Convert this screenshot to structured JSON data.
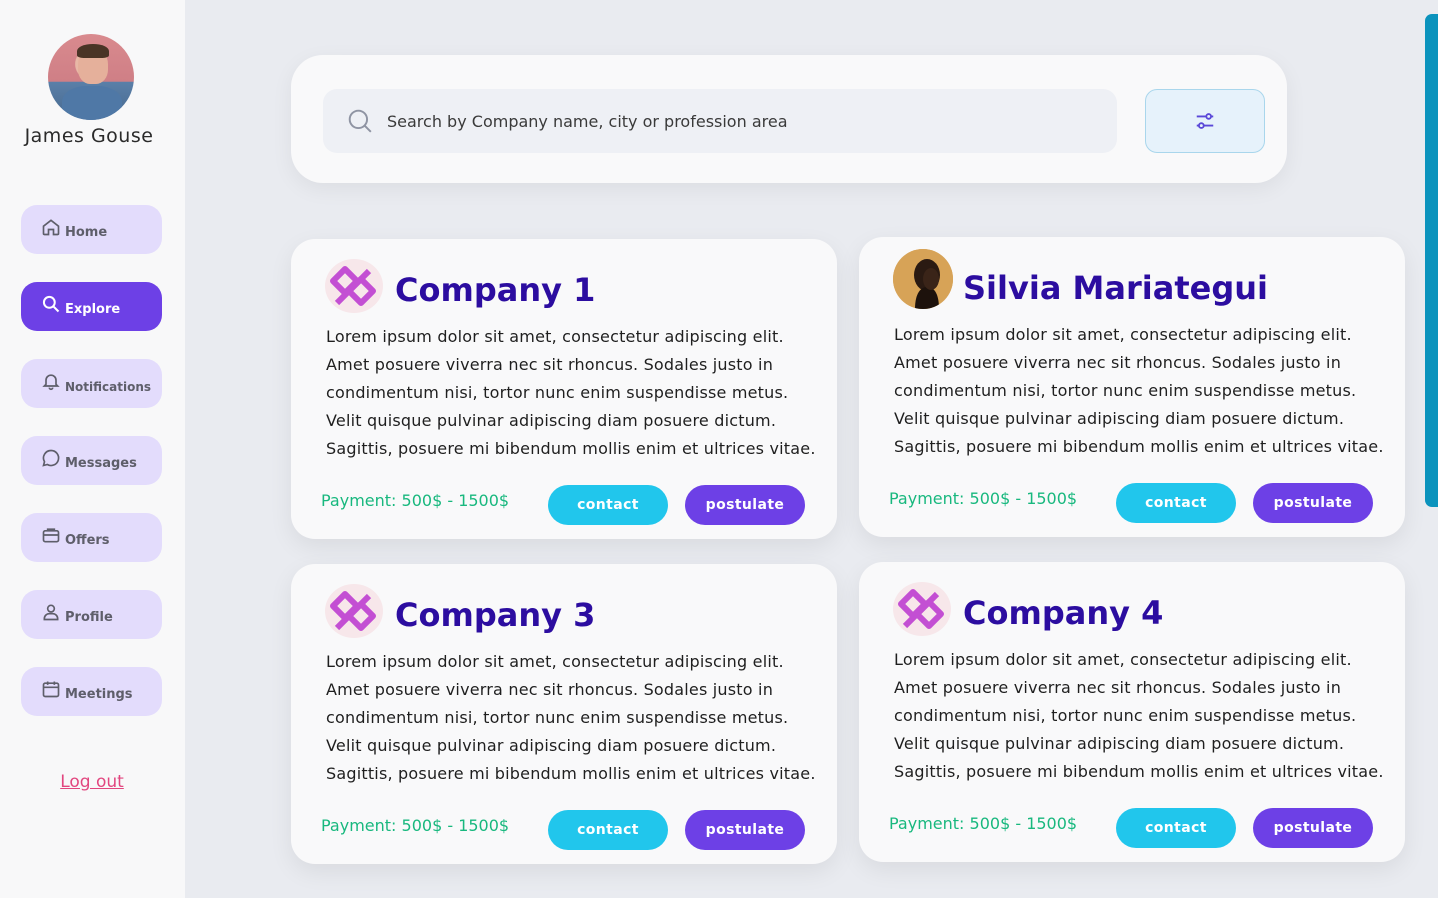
{
  "user": {
    "name": "James Gouse"
  },
  "nav": [
    {
      "label": "Home",
      "icon": "home-icon"
    },
    {
      "label": "Explore",
      "icon": "search-icon",
      "active": true
    },
    {
      "label": "Notifications",
      "icon": "bell-icon"
    },
    {
      "label": "Messages",
      "icon": "chat-icon"
    },
    {
      "label": "Offers",
      "icon": "briefcase-icon"
    },
    {
      "label": "Profile",
      "icon": "user-icon"
    },
    {
      "label": "Meetings",
      "icon": "calendar-icon"
    }
  ],
  "logout_label": "Log out",
  "search": {
    "placeholder": "Search by Company name, city or profession area",
    "value": ""
  },
  "cards": [
    {
      "title": "Company 1",
      "description": "Lorem ipsum dolor sit amet, consectetur adipiscing elit. Amet posuere viverra nec sit rhoncus. Sodales justo in condimentum nisi, tortor nunc enim suspendisse metus. Velit quisque pulvinar adipiscing diam posuere dictum. Sagittis, posuere mi bibendum mollis enim et ultrices vitae.",
      "payment": "Payment: 500$ - 1500$",
      "contact_label": "contact",
      "postulate_label": "postulate"
    },
    {
      "title": "Silvia Mariategui",
      "description": "Lorem ipsum dolor sit amet, consectetur adipiscing elit. Amet posuere viverra nec sit rhoncus. Sodales justo in condimentum nisi, tortor nunc enim suspendisse metus. Velit quisque pulvinar adipiscing diam posuere dictum. Sagittis, posuere mi bibendum mollis enim et ultrices vitae.",
      "payment": "Payment: 500$ - 1500$",
      "contact_label": "contact",
      "postulate_label": "postulate"
    },
    {
      "title": "Company 3",
      "description": "Lorem ipsum dolor sit amet, consectetur adipiscing elit. Amet posuere viverra nec sit rhoncus. Sodales justo in condimentum nisi, tortor nunc enim suspendisse metus. Velit quisque pulvinar adipiscing diam posuere dictum. Sagittis, posuere mi bibendum mollis enim et ultrices vitae.",
      "payment": "Payment: 500$ - 1500$",
      "contact_label": "contact",
      "postulate_label": "postulate"
    },
    {
      "title": "Company 4",
      "description": "Lorem ipsum dolor sit amet, consectetur adipiscing elit. Amet posuere viverra nec sit rhoncus. Sodales justo in condimentum nisi, tortor nunc enim suspendisse metus. Velit quisque pulvinar adipiscing diam posuere dictum. Sagittis, posuere mi bibendum mollis enim et ultrices vitae.",
      "payment": "Payment: 500$ - 1500$",
      "contact_label": "contact",
      "postulate_label": "postulate"
    }
  ],
  "colors": {
    "accent": "#6d40e6",
    "nav_bg": "#e3dcfc",
    "contact": "#21c6ec",
    "title": "#2c0da0",
    "payment": "#18b87e",
    "logout": "#e2467f"
  }
}
